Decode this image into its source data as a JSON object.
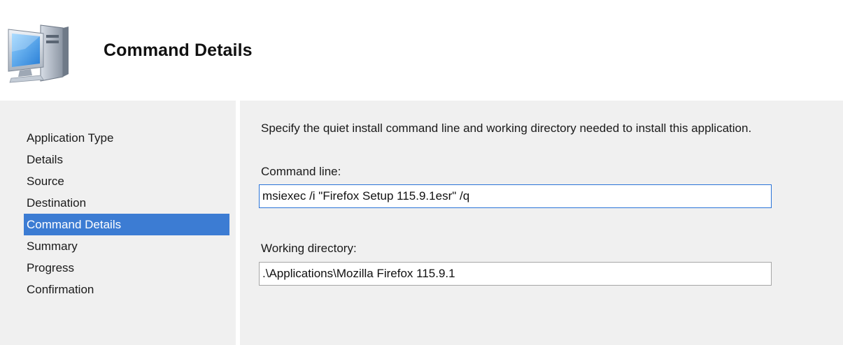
{
  "header": {
    "title": "Command Details",
    "icon": "computer-icon"
  },
  "nav": {
    "items": [
      {
        "label": "Application Type",
        "active": false
      },
      {
        "label": "Details",
        "active": false
      },
      {
        "label": "Source",
        "active": false
      },
      {
        "label": "Destination",
        "active": false
      },
      {
        "label": "Command Details",
        "active": true
      },
      {
        "label": "Summary",
        "active": false
      },
      {
        "label": "Progress",
        "active": false
      },
      {
        "label": "Confirmation",
        "active": false
      }
    ]
  },
  "main": {
    "instructions": "Specify the quiet install command line and working directory needed to install this application.",
    "command_line": {
      "label": "Command line:",
      "value": "msiexec /i \"Firefox Setup 115.9.1esr\" /q"
    },
    "working_directory": {
      "label": "Working directory:",
      "value": ".\\Applications\\Mozilla Firefox 115.9.1"
    }
  },
  "colors": {
    "selection": "#3c7cd3",
    "pane_background": "#f0f0f0",
    "focus_border": "#2a73d8"
  }
}
